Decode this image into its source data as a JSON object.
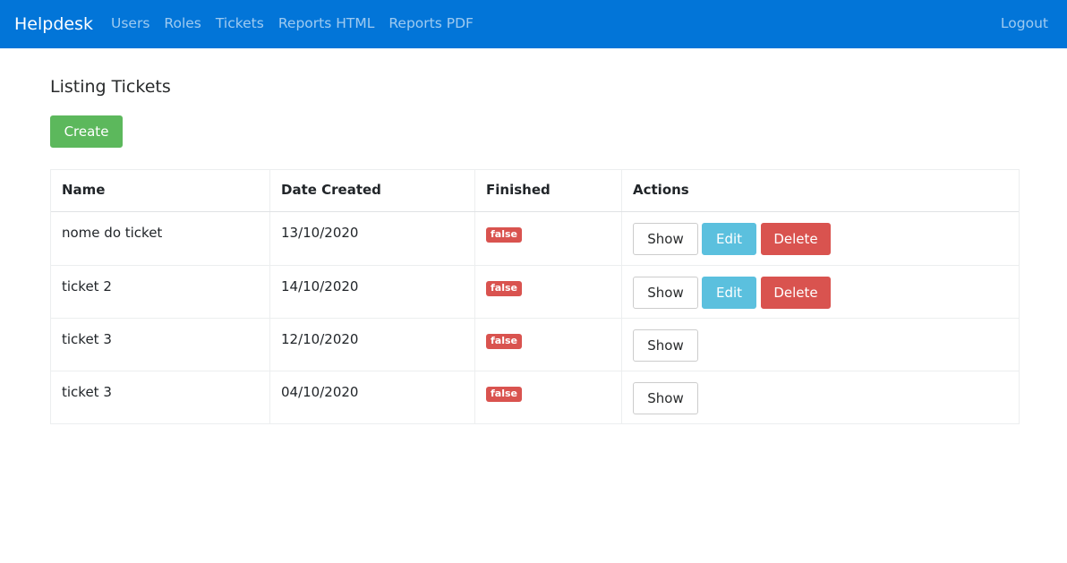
{
  "navbar": {
    "brand": "Helpdesk",
    "links": [
      "Users",
      "Roles",
      "Tickets",
      "Reports HTML",
      "Reports PDF"
    ],
    "logout": "Logout",
    "background": "#0275d8"
  },
  "page": {
    "title": "Listing Tickets",
    "create_label": "Create"
  },
  "table": {
    "headers": [
      "Name",
      "Date Created",
      "Finished",
      "Actions"
    ],
    "rows": [
      {
        "name": "nome do ticket",
        "date": "13/10/2020",
        "finished": "false",
        "actions": [
          "Show",
          "Edit",
          "Delete"
        ]
      },
      {
        "name": "ticket 2",
        "date": "14/10/2020",
        "finished": "false",
        "actions": [
          "Show",
          "Edit",
          "Delete"
        ]
      },
      {
        "name": "ticket 3",
        "date": "12/10/2020",
        "finished": "false",
        "actions": [
          "Show"
        ]
      },
      {
        "name": "ticket 3",
        "date": "04/10/2020",
        "finished": "false",
        "actions": [
          "Show"
        ]
      }
    ]
  },
  "colors": {
    "create": "#5cb85c",
    "edit": "#5bc0de",
    "delete": "#d9534f",
    "badge_false": "#d9534f"
  }
}
